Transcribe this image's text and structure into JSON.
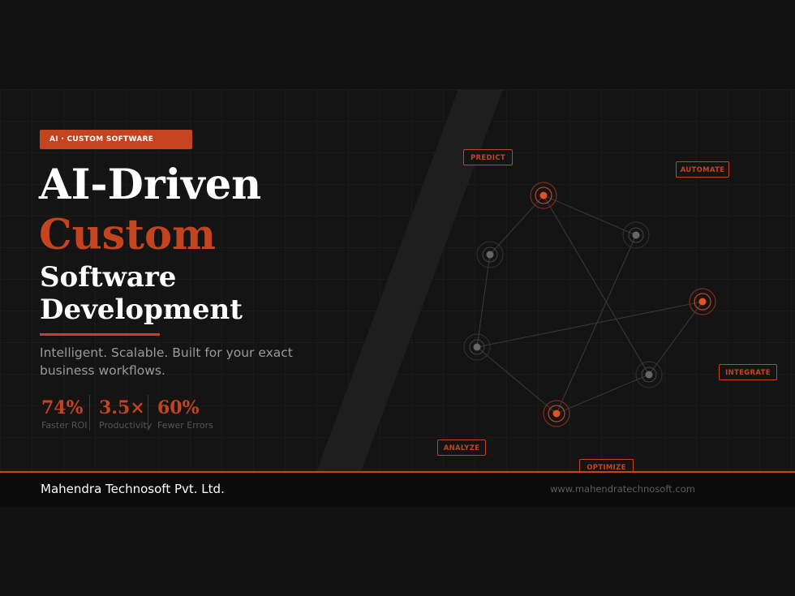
{
  "badge": "AI · CUSTOM SOFTWARE",
  "title": {
    "line1": "AI-Driven",
    "line2": "Custom",
    "line3": "Software",
    "line4": "Development"
  },
  "subtitle": "Intelligent. Scalable. Built for your exact business workflows.",
  "stats": [
    {
      "value": "74%",
      "label": "Faster ROI"
    },
    {
      "value": "3.5×",
      "label": "Productivity"
    },
    {
      "value": "60%",
      "label": "Fewer Errors"
    }
  ],
  "tags": {
    "predict": "PREDICT",
    "automate": "AUTOMATE",
    "integrate": "INTEGRATE",
    "analyze": "ANALYZE",
    "optimize": "OPTIMIZE"
  },
  "footer": {
    "company": "Mahendra Technosoft Pvt. Ltd.",
    "website": "www.mahendratechnosoft.com"
  },
  "colors": {
    "accent": "#c4441f",
    "background": "#111111",
    "panel": "#141414"
  }
}
